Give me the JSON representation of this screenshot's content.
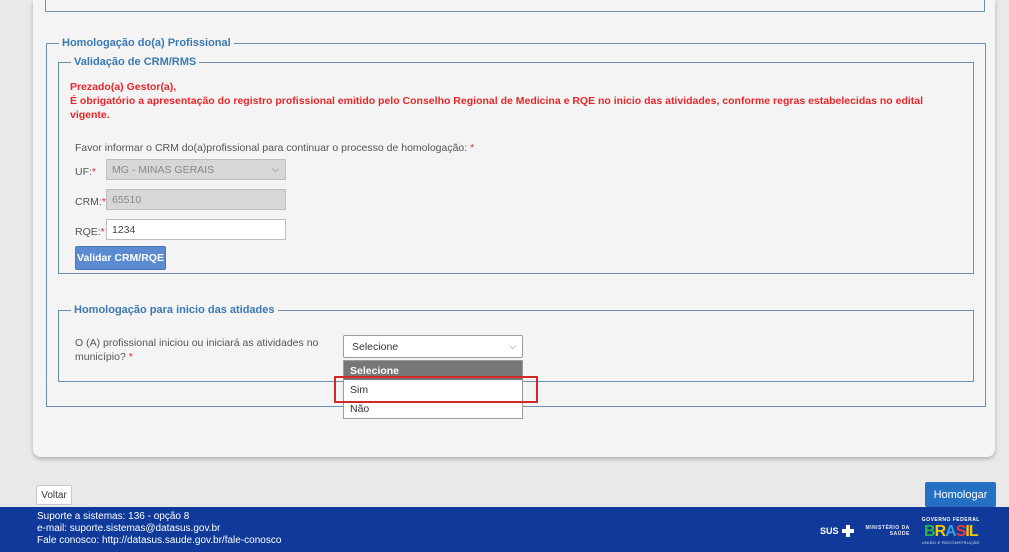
{
  "section_outer": {
    "legend": "Homologação do(a) Profissional"
  },
  "section_crm": {
    "legend": "Validação de CRM/RMS",
    "warning_line1": "Prezado(a) Gestor(a),",
    "warning_line2": "É obrigatório a apresentação do registro profissional emitido pelo Conselho Regional de Medicina e RQE no inicio das atividades, conforme regras estabelecidas no edital",
    "warning_line3": "vigente.",
    "instruction": "Favor informar o CRM do(a)profissional para continuar o processo de homologação:",
    "uf_label": "UF:",
    "uf_value": "MG - MINAS GERAIS",
    "crm_label": "CRM:",
    "crm_value": "65510",
    "rqe_label": "RQE:",
    "rqe_value": "1234",
    "validate_button": "Validar CRM/RQE"
  },
  "section_inicio": {
    "legend": "Homologação para inicio das atidades",
    "question_line1": "O (A) profissional iniciou ou iniciará as atividades no",
    "question_line2": "município?",
    "select_value": "Selecione",
    "options": [
      "Selecione",
      "Sim",
      "Não"
    ],
    "highlighted_option": "Sim"
  },
  "actions": {
    "back": "Voltar",
    "submit": "Homologar"
  },
  "footer": {
    "line1": "Suporte a sistemas: 136 - opção 8",
    "line2": "e-mail: suporte.sistemas@datasus.gov.br",
    "line3": "Fale conosco: http://datasus.saude.gov.br/fale-conosco",
    "logo_sus": "SUS",
    "logo_ms_line1": "MINISTÉRIO DA",
    "logo_ms_line2": "SAÚDE",
    "logo_gov_top": "GOVERNO FEDERAL",
    "logo_gov_letters": [
      "B",
      "R",
      "A",
      "S",
      "IL"
    ],
    "logo_gov_bottom": "UNIÃO E RECONSTRUÇÃO"
  },
  "colors": {
    "accent": "#3a79b4",
    "warning": "#e8262a",
    "footer_bg": "#0f3a9a",
    "primary_button": "#2670c4",
    "highlight": "#d12828"
  }
}
